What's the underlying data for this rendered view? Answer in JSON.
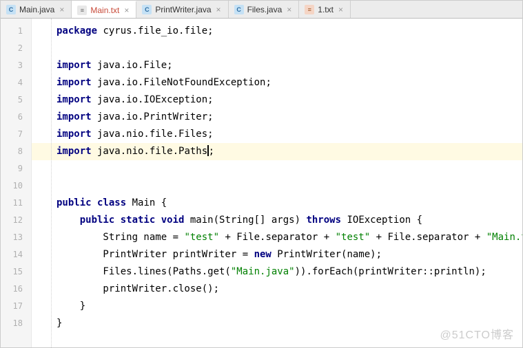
{
  "tabs": [
    {
      "label": "Main.java",
      "iconText": "C",
      "iconClass": "java",
      "active": false
    },
    {
      "label": "Main.txt",
      "iconText": "≡",
      "iconClass": "txt",
      "active": true
    },
    {
      "label": "PrintWriter.java",
      "iconText": "C",
      "iconClass": "java",
      "active": false
    },
    {
      "label": "Files.java",
      "iconText": "C",
      "iconClass": "java",
      "active": false
    },
    {
      "label": "1.txt",
      "iconText": "≡",
      "iconClass": "dat",
      "active": false
    }
  ],
  "lines": [
    {
      "n": "1",
      "hl": false,
      "html": "<span class='kw'>package</span> cyrus.file_io.file;"
    },
    {
      "n": "2",
      "hl": false,
      "html": ""
    },
    {
      "n": "3",
      "hl": false,
      "html": "<span class='kw'>import</span> java.io.File;"
    },
    {
      "n": "4",
      "hl": false,
      "html": "<span class='kw'>import</span> java.io.FileNotFoundException;"
    },
    {
      "n": "5",
      "hl": false,
      "html": "<span class='kw'>import</span> java.io.IOException;"
    },
    {
      "n": "6",
      "hl": false,
      "html": "<span class='kw'>import</span> java.io.PrintWriter;"
    },
    {
      "n": "7",
      "hl": false,
      "html": "<span class='kw'>import</span> java.nio.file.Files;"
    },
    {
      "n": "8",
      "hl": true,
      "html": "<span class='kw'>import</span> java.nio.file.Paths<span class='caret'></span>;"
    },
    {
      "n": "9",
      "hl": false,
      "html": ""
    },
    {
      "n": "10",
      "hl": false,
      "html": ""
    },
    {
      "n": "11",
      "hl": false,
      "html": "<span class='kw'>public class</span> Main {"
    },
    {
      "n": "12",
      "hl": false,
      "html": "    <span class='kw'>public static void</span> main(String[] args) <span class='kw'>throws</span> IOException {"
    },
    {
      "n": "13",
      "hl": false,
      "html": "        String name = <span class='str'>\"test\"</span> + File.separator + <span class='str'>\"test\"</span> + File.separator + <span class='str'>\"Main.txt\"</span>"
    },
    {
      "n": "14",
      "hl": false,
      "html": "        PrintWriter printWriter = <span class='kw'>new</span> PrintWriter(name);"
    },
    {
      "n": "15",
      "hl": false,
      "html": "        Files.lines(Paths.get(<span class='str'>\"Main.java\"</span>)).forEach(printWriter::println);"
    },
    {
      "n": "16",
      "hl": false,
      "html": "        printWriter.close();"
    },
    {
      "n": "17",
      "hl": false,
      "html": "    }"
    },
    {
      "n": "18",
      "hl": false,
      "html": "}"
    }
  ],
  "watermark": "@51CTO博客"
}
